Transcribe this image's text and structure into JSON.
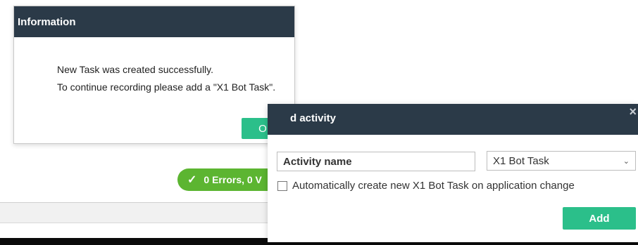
{
  "info_dialog": {
    "title": "Information",
    "line1": "New Task was created successfully.",
    "line2": "To continue recording please add a \"X1 Bot Task\".",
    "ok_label": "OK"
  },
  "status": {
    "text": "0 Errors, 0 V",
    "icon": "check-icon"
  },
  "activity_dialog": {
    "title": "d activity",
    "close_icon": "×",
    "name_placeholder": "Activity name",
    "type_selected": "X1 Bot Task",
    "auto_label": "Automatically create new X1 Bot Task on application change",
    "add_label": "Add"
  },
  "colors": {
    "header": "#2b3a48",
    "accent_button": "#2bbf8a",
    "status_green": "#5cb531"
  }
}
